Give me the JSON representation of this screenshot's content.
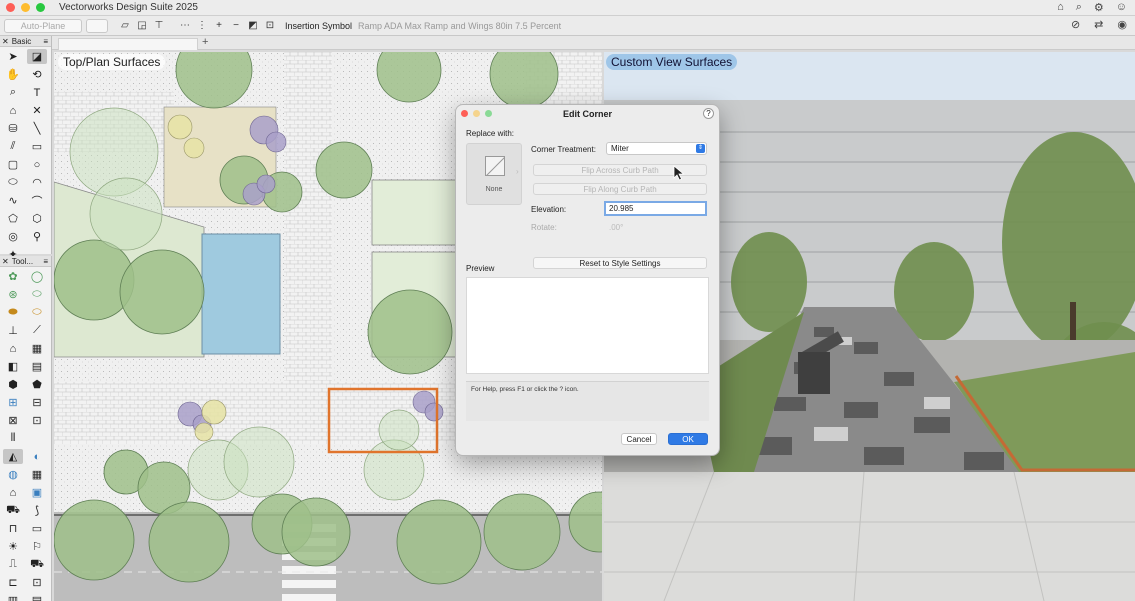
{
  "app": {
    "title": "Vectorworks Design Suite 2025"
  },
  "toolbar": {
    "auto_plane": "Auto-Plane",
    "insertion_symbol_label": "Insertion Symbol",
    "insertion_symbol_value": "Ramp ADA Max Ramp and Wings 80in 7.5 Percent"
  },
  "palettes": {
    "basic": {
      "title": "Basic"
    },
    "tools": {
      "title": "Tool..."
    }
  },
  "views": {
    "plan": {
      "label": "Top/Plan  Surfaces"
    },
    "custom": {
      "label": "Custom View  Surfaces"
    }
  },
  "dialog": {
    "title": "Edit Corner",
    "replace_with": "Replace with:",
    "none_label": "None",
    "corner_treatment_label": "Corner Treatment:",
    "corner_treatment_value": "Miter",
    "flip_across": "Flip Across Curb Path",
    "flip_along": "Flip Along Curb Path",
    "elevation_label": "Elevation:",
    "elevation_value": "20.985",
    "rotate_label": "Rotate:",
    "rotate_value": ".00°",
    "reset_button": "Reset to Style Settings",
    "preview_label": "Preview",
    "help_text": "For Help, press F1 or click the ? icon.",
    "cancel": "Cancel",
    "ok": "OK"
  }
}
